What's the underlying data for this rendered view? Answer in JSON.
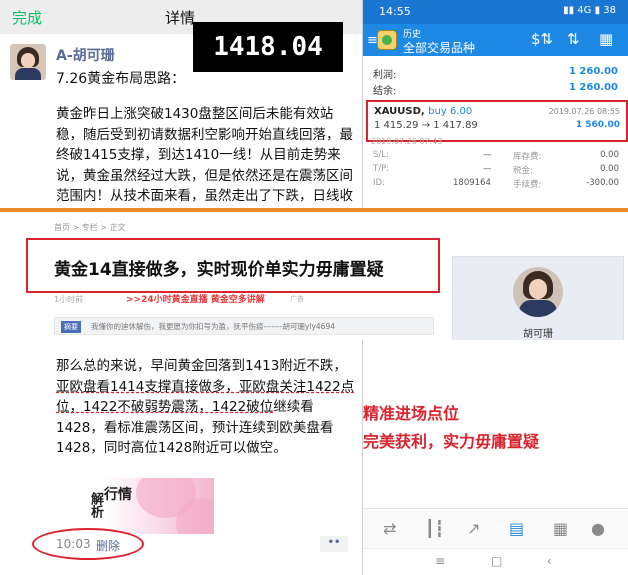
{
  "wechat": {
    "done_label": "完成",
    "title": "详情",
    "author": "A-胡可珊",
    "post_title": "7.26黄金布局思路：",
    "post_body": "黄金昨日上涨突破1430盘整区间后未能有效站稳，随后受到初请数据利空影响开始直线回落，最终破1415支撑，到达1410一线！从目前走势来说，黄金虽然经过大跌，但是依然还是在震荡区间范围内！从技术面来看，虽然走出了下跌，日线收阴，但是收线并没",
    "body2_prefix": "那么总的来说，早间黄金回落到1413附近不跌，",
    "body2_underlined": "亚欧盘看1414支撑直接做多，亚欧盘关注1422点位，1422不破弱势震荡，1422破位",
    "body2_suffix": "继续看1428，看标准震荡区间，预计连续到欧美盘看1428，同时高位1428附近可以做空。",
    "time": "10:03",
    "delete_label": "删除",
    "more_label": "••",
    "thumb_text_1": "行情",
    "thumb_text_2": "解析"
  },
  "price_display": "1418.04",
  "mt4": {
    "status_time": "14:55",
    "status_icons": "▮▮ 4G ▮ 38",
    "menu_title_small": "历史",
    "menu_title": "全部交易品种",
    "profit_label": "利润:",
    "profit_value": "1 260.00",
    "balance_label": "结余:",
    "balance_value": "1 260.00",
    "trade": {
      "symbol": "XAUUSD,",
      "side": "buy 6.00",
      "date": "2019.07.26 08:55",
      "prices": "1 415.29 → 1 417.89",
      "pl": "1 560.00",
      "open_date": "2019.07.26 07:43"
    },
    "details": [
      {
        "label": "S/L:",
        "value": "—",
        "label2": "库存费:",
        "value2": "0.00"
      },
      {
        "label": "T/P:",
        "value": "—",
        "label2": "税金:",
        "value2": "0.00"
      },
      {
        "label": "ID:",
        "value": "1809164",
        "label2": "手续费:",
        "value2": "-300.00"
      }
    ]
  },
  "article": {
    "breadcrumb": "首页 > 专栏 > 正文",
    "headline": "黄金14直接做多，实时现价单实力毋庸置疑",
    "meta": "1小时前",
    "promo": ">>24小时黄金直播 黄金空多讲解",
    "promo_ad": "广告",
    "summary_tag": "摘要",
    "summary_text": "我懂你的迪休解伤，我更愿为你扣号为盈，抚平伤痕-------胡可珊yly4694",
    "author_name": "胡可珊"
  },
  "annotation": {
    "line1": "精准进场点位",
    "line2": "完美获利，实力毋庸置疑"
  },
  "colors": {
    "wechat_green": "#07c160",
    "wechat_link": "#576b95",
    "mt4_blue": "#1e88e5",
    "highlight_red": "#d9232d",
    "divider_orange": "#ec8a2b"
  }
}
